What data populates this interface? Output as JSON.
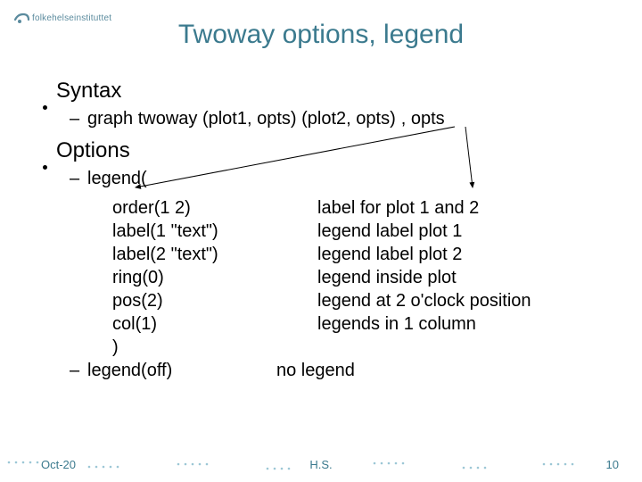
{
  "logo": {
    "text": "folkehelseinstituttet"
  },
  "title": "Twoway options, legend",
  "syntax": {
    "heading": "Syntax",
    "line_prefix": "graph twoway (plot1, opts) (plot2, opts)",
    "line_suffix": ", opts"
  },
  "options": {
    "heading": "Options",
    "legend_open": "legend(",
    "rows": [
      {
        "left": "order(1 2)",
        "right": "label for plot 1 and 2"
      },
      {
        "left": "label(1 \"text\")",
        "right": "legend label plot 1"
      },
      {
        "left": "label(2 \"text\")",
        "right": "legend label plot 2"
      },
      {
        "left": "ring(0)",
        "right": "legend inside plot"
      },
      {
        "left": "pos(2)",
        "right": "legend at 2 o'clock position"
      },
      {
        "left": "col(1)",
        "right": "legends in 1 column"
      },
      {
        "left": ")",
        "right": ""
      }
    ],
    "legend_off": {
      "left": "legend(off)",
      "right": "no legend"
    }
  },
  "footer": {
    "left": "Oct-20",
    "center": "H.S.",
    "right": "10"
  },
  "colors": {
    "accent": "#3b7a8e"
  }
}
